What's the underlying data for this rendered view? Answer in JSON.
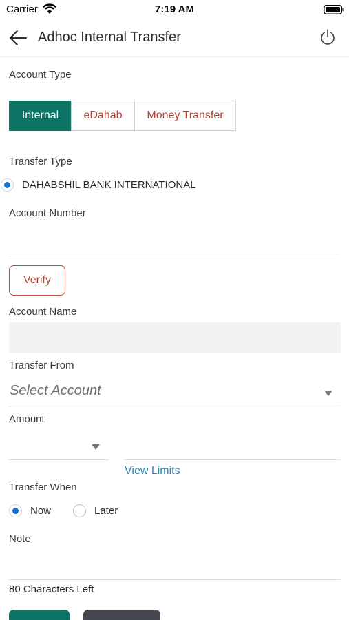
{
  "status_bar": {
    "carrier": "Carrier",
    "time": "7:19 AM"
  },
  "header": {
    "title": "Adhoc Internal Transfer"
  },
  "account_type": {
    "label": "Account Type",
    "options": [
      "Internal",
      "eDahab",
      "Money Transfer"
    ],
    "selected": "Internal"
  },
  "transfer_type": {
    "label": "Transfer Type",
    "option": "DAHABSHIL BANK INTERNATIONAL"
  },
  "account_number": {
    "label": "Account Number",
    "value": ""
  },
  "verify": {
    "label": "Verify"
  },
  "account_name": {
    "label": "Account Name",
    "value": ""
  },
  "transfer_from": {
    "label": "Transfer From",
    "placeholder": "Select Account"
  },
  "amount": {
    "label": "Amount",
    "currency": "",
    "value": ""
  },
  "view_limits": {
    "label": "View Limits"
  },
  "transfer_when": {
    "label": "Transfer When",
    "options": [
      "Now",
      "Later"
    ],
    "selected": "Now"
  },
  "note": {
    "label": "Note",
    "value": "",
    "chars_left": "80 Characters Left"
  },
  "colors": {
    "primary": "#0e7466",
    "accent_red": "#b2402f",
    "link": "#2a87b9",
    "radio": "#1473d4",
    "dark_button": "#44474d"
  }
}
